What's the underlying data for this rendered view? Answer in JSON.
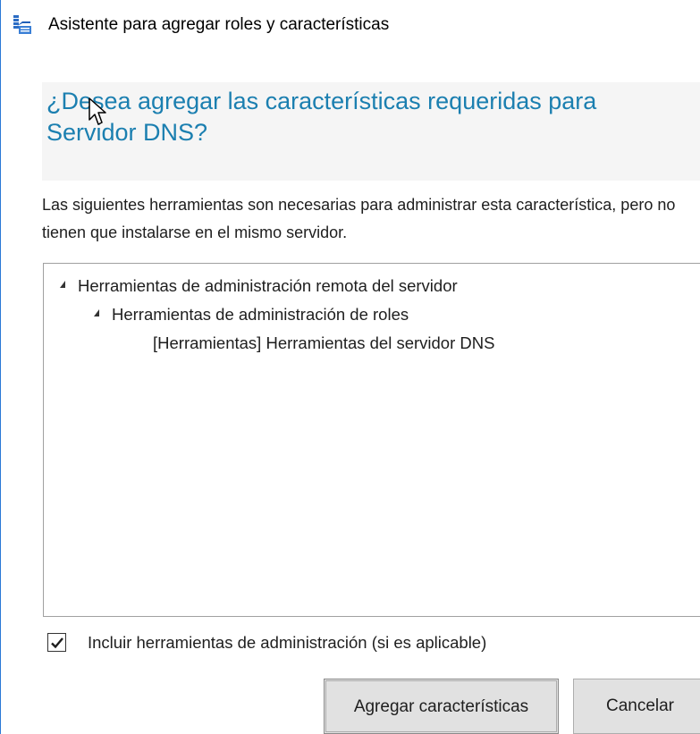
{
  "window": {
    "title": "Asistente para agregar roles y características"
  },
  "dialog": {
    "heading": "¿Desea agregar las características requeridas para Servidor DNS?",
    "description": "Las siguientes herramientas son necesarias para administrar esta característica, pero no tienen que instalarse en el mismo servidor."
  },
  "tree": {
    "items": [
      {
        "label": "Herramientas de administración remota del servidor",
        "expanded": true
      },
      {
        "label": "Herramientas de administración de roles",
        "expanded": true
      },
      {
        "label": "[Herramientas] Herramientas del servidor DNS"
      }
    ]
  },
  "options": {
    "include_tools_label": "Incluir herramientas de administración (si es aplicable)",
    "include_tools_checked": true
  },
  "buttons": {
    "add_features_label": "Agregar características",
    "cancel_label": "Cancelar"
  },
  "colors": {
    "heading": "#1b7fb0",
    "window_border": "#2b79d6",
    "button_face": "#e1e1e1"
  },
  "icons": {
    "title": "server-manager-icon",
    "expander": "triangle-expanded-icon",
    "check": "checkmark-icon",
    "cursor": "mouse-pointer-icon"
  }
}
